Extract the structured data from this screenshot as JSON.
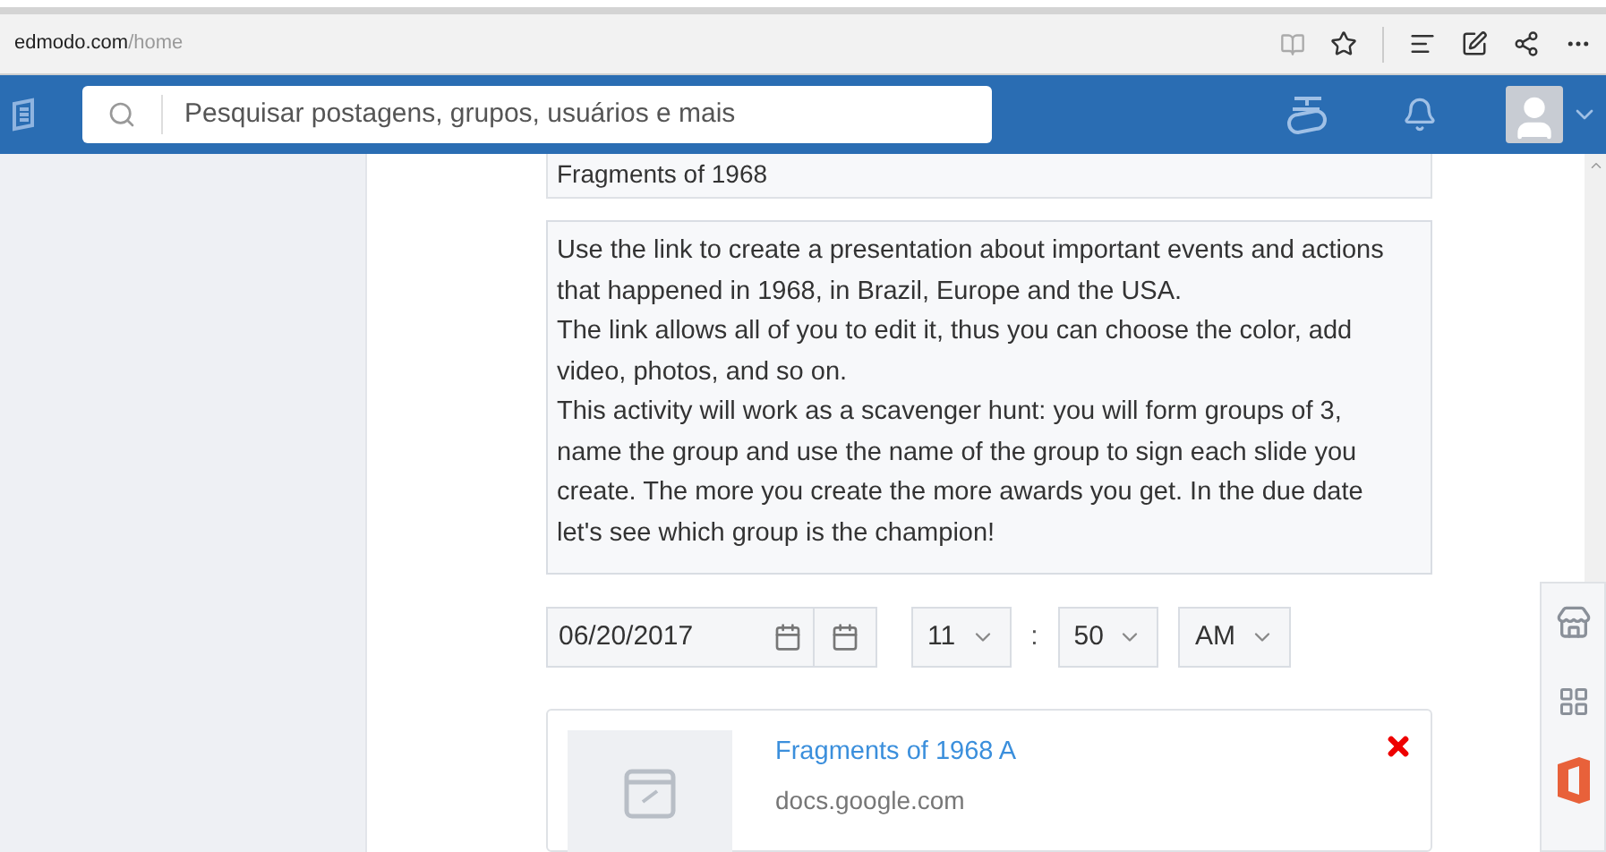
{
  "browser": {
    "url_host": "edmodo.com",
    "url_path": "/home"
  },
  "search": {
    "placeholder": "Pesquisar postagens, grupos, usuários e mais"
  },
  "assignment": {
    "title": "Fragments of 1968",
    "description": "Use the link to create a presentation about important events and actions that happened in 1968, in Brazil, Europe and the USA.\nThe link allows all of you to edit it, thus you can choose the color, add video, photos, and so on.\nThis activity will work as a scavenger hunt: you will form groups of 3, name the group and use the name of the group to sign each slide you create. The more you create the more awards you get. In the due date let's see which group is the champion!",
    "due_date": "06/20/2017",
    "hour": "11",
    "separator": ":",
    "minute": "50",
    "period": "AM",
    "attachment": {
      "title": "Fragments of 1968 A",
      "source": "docs.google.com"
    }
  }
}
